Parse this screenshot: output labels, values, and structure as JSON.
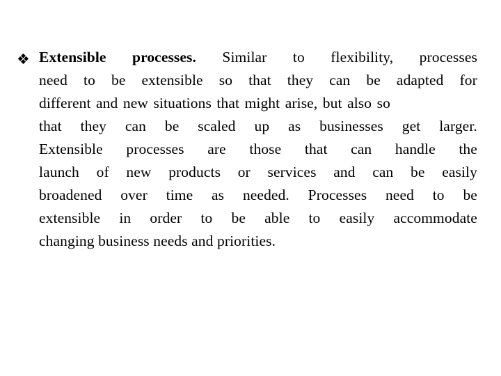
{
  "slide": {
    "background_color": "#ffffff",
    "text_color": "#000000",
    "bullet": {
      "icon": "four-diamond-bullet-icon",
      "glyph": "❖"
    },
    "paragraph": {
      "lead_bold": "Extensible processes.",
      "rest": "Similar to flexibility, processes need to be extensible so that they can be adapted for different and new situations that might arise, but also so that they can be scaled up as businesses get larger. Extensible processes are those that can handle the launch of new products or services and can be easily broadened over time as needed. Processes need to be extensible in order to be able to easily accommodate changing business needs and priorities.",
      "lines": [
        "Extensible processes. Similar to flexibility, processes",
        "need to be extensible so that they can be adapted for",
        "different and new situations that might arise, but also so",
        "that they can be scaled up as businesses get larger.",
        "Extensible processes are those that can handle the",
        "launch of new products or services and can be easily",
        "broadened over time as needed. Processes need to be",
        "extensible in order to be able to easily accommodate",
        "changing business needs and priorities."
      ]
    }
  }
}
